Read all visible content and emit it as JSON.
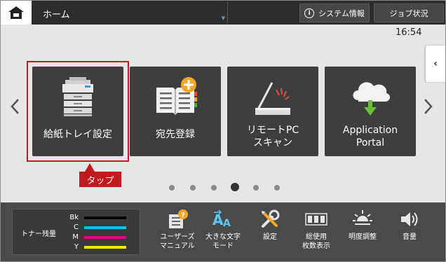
{
  "topbar": {
    "title": "ホーム",
    "system_info_label": "システム情報",
    "job_status_label": "ジョブ状況"
  },
  "main": {
    "clock": "16:54",
    "tiles": [
      {
        "label": "給紙トレイ設定",
        "icon": "printer-icon"
      },
      {
        "label": "宛先登録",
        "icon": "address-book-add-icon"
      },
      {
        "label_lines": [
          "リモートPC",
          "スキャン"
        ],
        "icon": "scanner-icon"
      },
      {
        "label_lines": [
          "Application",
          "Portal"
        ],
        "icon": "cloud-download-icon"
      }
    ],
    "tap_label": "タップ",
    "page_count": 6,
    "active_page": 4
  },
  "bottombar": {
    "toner_label": "トナー残量",
    "toner": [
      {
        "name": "Bk",
        "color": "#000000"
      },
      {
        "name": "C",
        "color": "#00c8e8"
      },
      {
        "name": "M",
        "color": "#e6008c"
      },
      {
        "name": "Y",
        "color": "#f0e600"
      }
    ],
    "buttons": [
      {
        "label_lines": [
          "ユーザーズ",
          "マニュアル"
        ],
        "icon": "manual-icon"
      },
      {
        "label_lines": [
          "大きな文字",
          "モード"
        ],
        "icon": "large-text-icon"
      },
      {
        "label_lines": [
          "設定"
        ],
        "icon": "settings-tools-icon"
      },
      {
        "label_lines": [
          "総使用",
          "枚数表示"
        ],
        "icon": "counter-icon"
      },
      {
        "label_lines": [
          "明度調整"
        ],
        "icon": "brightness-icon"
      },
      {
        "label_lines": [
          "音量"
        ],
        "icon": "volume-icon"
      }
    ]
  },
  "colors": {
    "accent_red": "#c0191e",
    "tile_bg": "#3e3e3e",
    "badge_orange": "#f5a623"
  }
}
